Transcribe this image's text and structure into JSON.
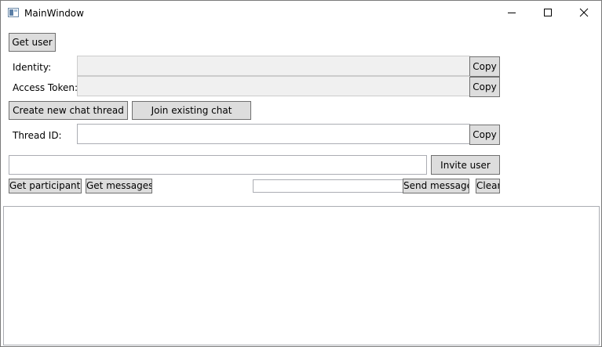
{
  "window": {
    "title": "MainWindow",
    "icons": {
      "app": "window-app-icon",
      "minimize": "minimize-icon",
      "maximize": "maximize-icon",
      "close": "close-icon"
    }
  },
  "user": {
    "get_user_label": "Get user",
    "identity_label": "Identity:",
    "identity_value": "",
    "access_token_label": "Access Token:",
    "access_token_value": "",
    "copy_label": "Copy"
  },
  "thread": {
    "create_label": "Create new chat thread",
    "join_label": "Join existing chat",
    "thread_id_label": "Thread ID:",
    "thread_id_value": "",
    "copy_label": "Copy"
  },
  "invite": {
    "user_value": "",
    "invite_label": "Invite user"
  },
  "actions": {
    "get_participants_label": "Get participants",
    "get_messages_label": "Get messages",
    "message_value": "",
    "send_message_label": "Send message",
    "clear_label": "Clear"
  },
  "output": {
    "text": ""
  }
}
